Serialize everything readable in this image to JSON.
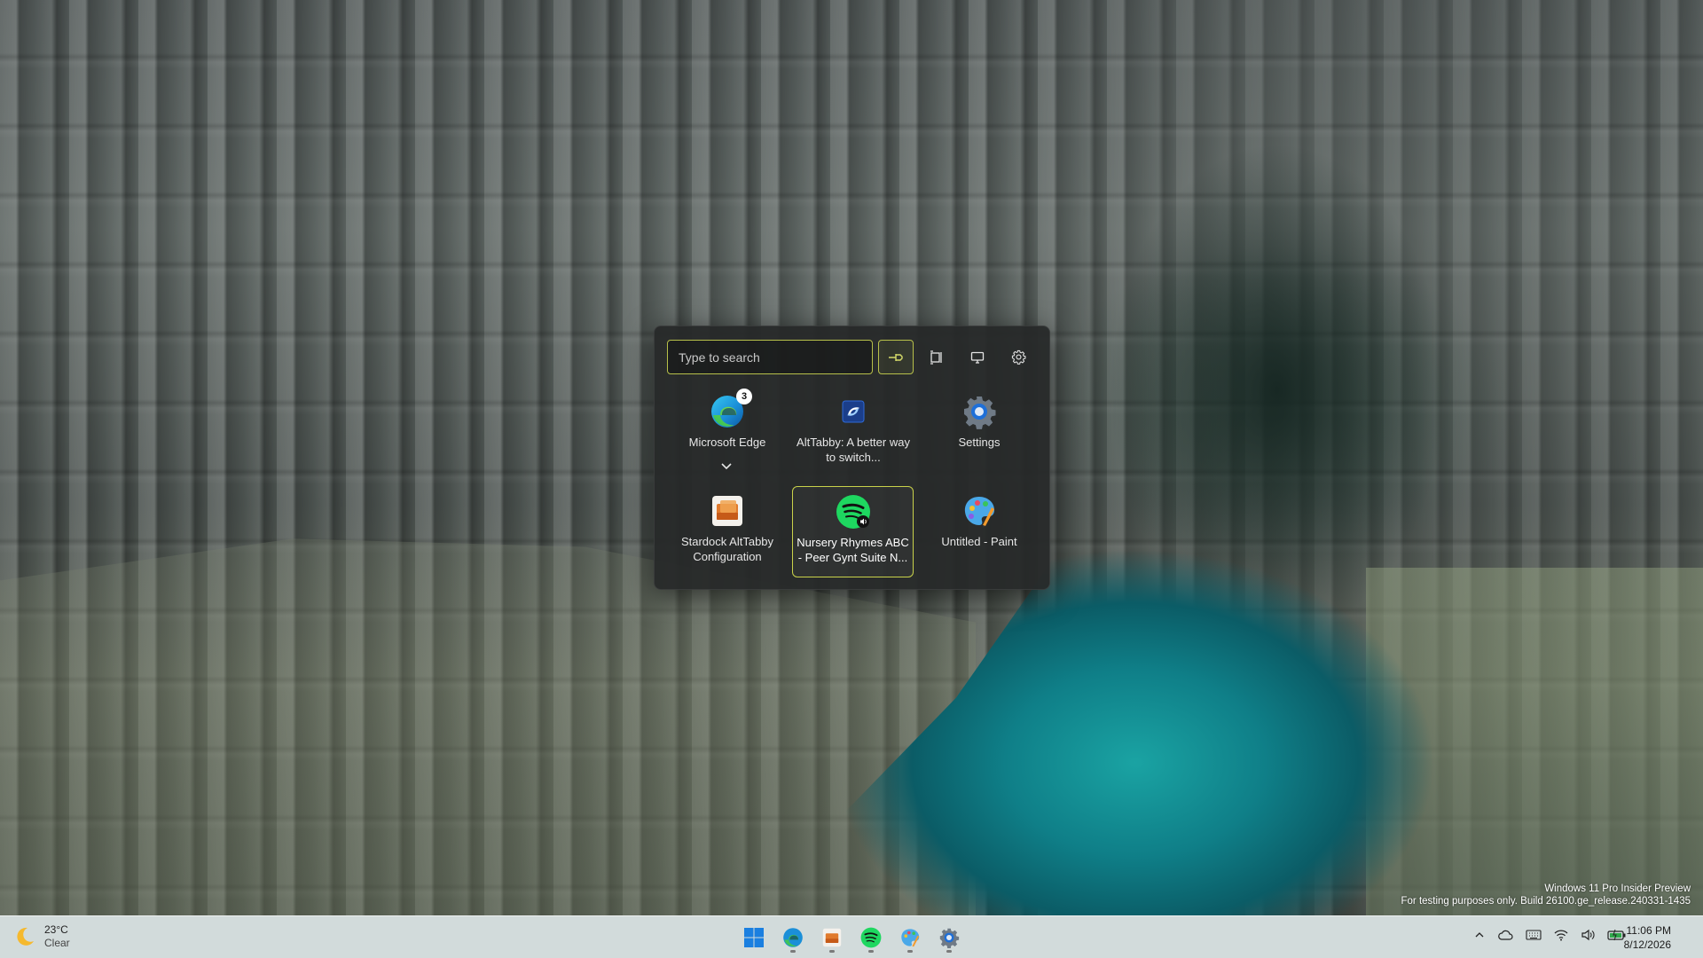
{
  "desktop": {
    "watermark": {
      "line1": "Windows 11 Pro Insider Preview",
      "line2": "For testing purposes only. Build 26100.ge_release.240331-1435"
    }
  },
  "switcher": {
    "search_placeholder": "Type to search",
    "accent_color": "#c9d24a",
    "toolbar_icons": [
      "pin-icon",
      "snap-layout-icon",
      "monitor-icon",
      "gear-icon"
    ],
    "apps": [
      {
        "name": "Microsoft Edge",
        "icon": "edge-icon",
        "badge": "3",
        "has_group": true,
        "selected": false
      },
      {
        "name": "AltTabby: A better way to switch...",
        "icon": "alttabby-icon",
        "selected": false
      },
      {
        "name": "Settings",
        "icon": "settings-gear-icon",
        "selected": false
      },
      {
        "name": "Stardock AltTabby Configuration",
        "icon": "stardock-icon",
        "selected": false
      },
      {
        "name": "Nursery Rhymes ABC - Peer Gynt Suite N...",
        "icon": "spotify-icon",
        "selected": true
      },
      {
        "name": "Untitled - Paint",
        "icon": "paint-icon",
        "selected": false
      }
    ]
  },
  "taskbar": {
    "weather": {
      "temp": "23°C",
      "condition": "Clear",
      "icon": "moon-icon"
    },
    "pinned": [
      "start-icon",
      "edge-icon",
      "stardock-icon",
      "spotify-icon",
      "paint-icon",
      "settings-gear-icon"
    ],
    "tray_icons": [
      "chevron-up-icon",
      "cloud-icon",
      "keyboard-icon",
      "wifi-icon",
      "volume-icon",
      "battery-icon"
    ],
    "time": "11:06 PM",
    "date": "8/12/2026"
  }
}
